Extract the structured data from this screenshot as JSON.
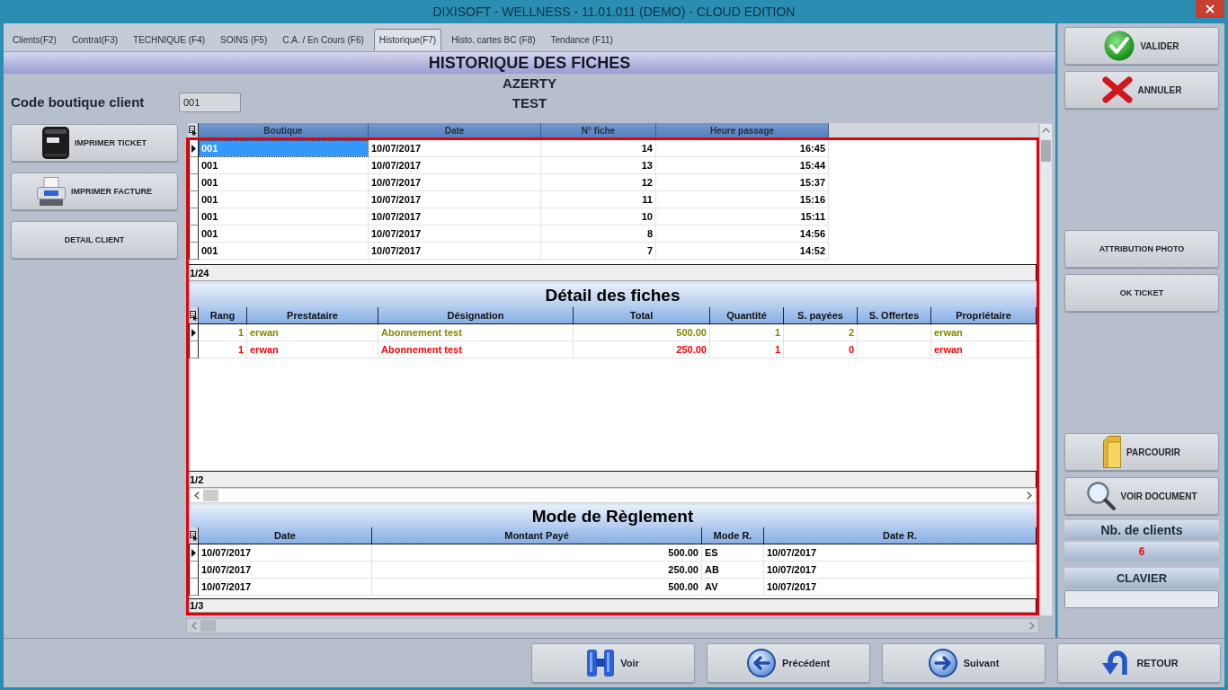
{
  "window": {
    "title": "DIXISOFT - WELLNESS - 11.01.011 (DEMO) - CLOUD EDITION"
  },
  "tabs": [
    {
      "label": "Clients(F2)",
      "selected": false
    },
    {
      "label": "Contrat(F3)",
      "selected": false
    },
    {
      "label": "TECHNIQUE (F4)",
      "selected": false
    },
    {
      "label": "SOINS (F5)",
      "selected": false
    },
    {
      "label": "C.A. / En Cours (F6)",
      "selected": false
    },
    {
      "label": "Historique(F7)",
      "selected": true
    },
    {
      "label": "Histo. cartes BC (F8)",
      "selected": false
    },
    {
      "label": "Tendance (F11)",
      "selected": false
    }
  ],
  "page_title": "HISTORIQUE DES FICHES",
  "client_lines": [
    "AZERTY",
    "TEST"
  ],
  "boutique_code": {
    "label": "Code boutique client",
    "value": "001"
  },
  "left_actions": [
    {
      "label": "IMPRIMER TICKET",
      "kind": "ticket"
    },
    {
      "label": "IMPRIMER FACTURE",
      "kind": "invoice"
    },
    {
      "label": "DETAIL CLIENT",
      "kind": "text"
    }
  ],
  "fiches": {
    "has_focus": true,
    "columns": [
      "Boutique",
      "Date",
      "N° fiche",
      "Heure passage"
    ],
    "rows": [
      {
        "selected": true,
        "boutique": "001",
        "date": "10/07/2017",
        "numero": "14",
        "heure": "16:45"
      },
      {
        "selected": false,
        "boutique": "001",
        "date": "10/07/2017",
        "numero": "13",
        "heure": "15:44"
      },
      {
        "selected": false,
        "boutique": "001",
        "date": "10/07/2017",
        "numero": "12",
        "heure": "15:37"
      },
      {
        "selected": false,
        "boutique": "001",
        "date": "10/07/2017",
        "numero": "11",
        "heure": "15:16"
      },
      {
        "selected": false,
        "boutique": "001",
        "date": "10/07/2017",
        "numero": "10",
        "heure": "15:11"
      },
      {
        "selected": false,
        "boutique": "001",
        "date": "10/07/2017",
        "numero": "8",
        "heure": "14:56"
      },
      {
        "selected": false,
        "boutique": "001",
        "date": "10/07/2017",
        "numero": "7",
        "heure": "14:52"
      }
    ],
    "status": "1/24"
  },
  "details": {
    "title": "Détail des fiches",
    "columns": [
      "Rang",
      "Prestataire",
      "Désignation",
      "Total",
      "Quantité",
      "S. payées",
      "S. Offertes",
      "Propriétaire"
    ],
    "rows": [
      {
        "selected": true,
        "color": "#868600",
        "rang": "1",
        "prestataire": "erwan",
        "designation": "Abonnement test",
        "total": "500.00",
        "quantite": "1",
        "s_payees": "2",
        "proprietaire": "erwan"
      },
      {
        "selected": false,
        "color": "#ff0000",
        "rang": "1",
        "prestataire": "erwan",
        "designation": "Abonnement test",
        "total": "250.00",
        "quantite": "1",
        "s_payees": "0",
        "proprietaire": "erwan"
      }
    ],
    "status": "1/2"
  },
  "payments": {
    "title": "Mode de Règlement",
    "columns": [
      "Date",
      "Montant Payé",
      "Mode R.",
      "Date R."
    ],
    "rows": [
      {
        "selected": true,
        "date": "10/07/2017",
        "montant": "500.00",
        "mode": "ES",
        "date_r": "10/07/2017"
      },
      {
        "selected": false,
        "date": "10/07/2017",
        "montant": "250.00",
        "mode": "AB",
        "date_r": "10/07/2017"
      },
      {
        "selected": false,
        "date": "10/07/2017",
        "montant": "500.00",
        "mode": "AV",
        "date_r": "10/07/2017"
      }
    ],
    "status": "1/3"
  },
  "right_panel": {
    "groups": [
      {
        "buttons": [
          {
            "label": "VALIDER",
            "kind": "confirm"
          },
          {
            "label": "ANNULER",
            "kind": "cancel"
          }
        ]
      },
      {
        "buttons": [
          {
            "label": "ATTRIBUTION PHOTO",
            "kind": "text"
          },
          {
            "label": "OK TICKET",
            "kind": "text"
          }
        ]
      },
      {
        "buttons": [
          {
            "label": "PARCOURIR",
            "kind": "browse"
          },
          {
            "label": "VOIR DOCUMENT",
            "kind": "view"
          }
        ]
      }
    ],
    "clients_count": {
      "label": "Nb. de clients",
      "value": "6"
    },
    "keyboard": {
      "label": "CLAVIER"
    }
  },
  "nav_buttons": [
    {
      "label": "Voir",
      "kind": "view"
    },
    {
      "label": "Précédent",
      "kind": "previous"
    },
    {
      "label": "Suivant",
      "kind": "next"
    },
    {
      "label": "RETOUR",
      "kind": "back"
    }
  ]
}
